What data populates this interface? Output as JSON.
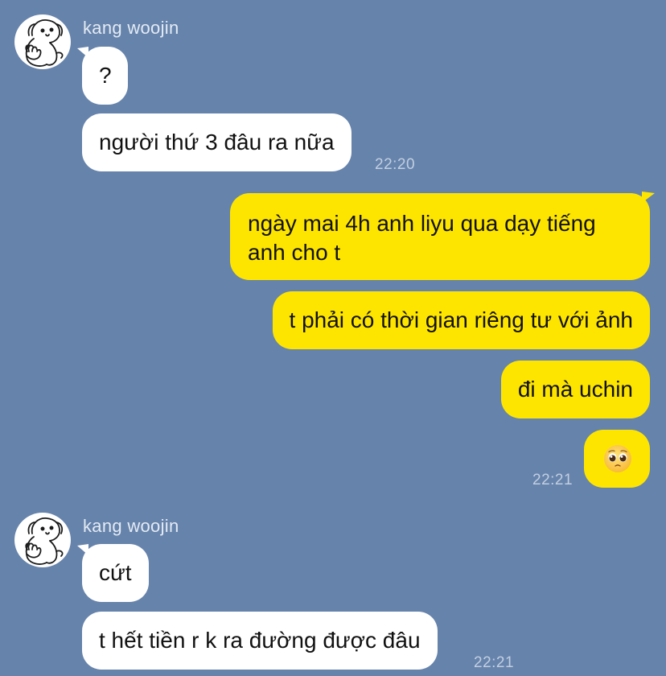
{
  "conversation": {
    "groups": [
      {
        "sender": "kang woojin",
        "messages": [
          {
            "text": "?"
          },
          {
            "text": "người thứ 3 đâu ra nữa",
            "time": "22:20"
          }
        ]
      },
      {
        "sender": "me",
        "messages": [
          {
            "text": "ngày mai 4h anh liyu qua dạy tiếng anh cho t"
          },
          {
            "text": "t phải có thời gian riêng tư với ảnh"
          },
          {
            "text": "đi mà uchin"
          },
          {
            "text": "",
            "emoji": "pleading-face",
            "time": "22:21"
          }
        ]
      },
      {
        "sender": "kang woojin",
        "messages": [
          {
            "text": "cứt"
          },
          {
            "text": "t hết tiền r k ra đường được đâu",
            "time": "22:21"
          }
        ]
      }
    ]
  },
  "colors": {
    "background": "#6683ab",
    "incoming_bubble": "#ffffff",
    "outgoing_bubble": "#fee500"
  }
}
